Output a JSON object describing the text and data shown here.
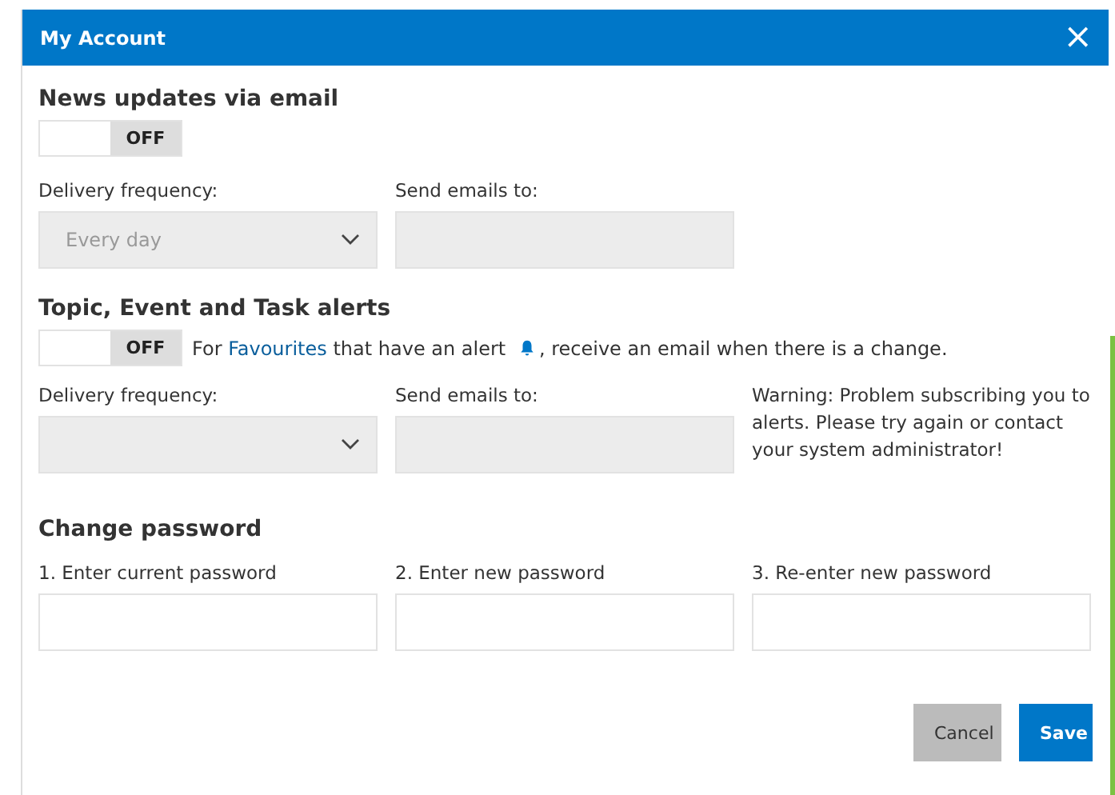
{
  "window": {
    "title": "My Account",
    "close": "×"
  },
  "news": {
    "heading": "News updates via email",
    "toggle": {
      "label": "OFF",
      "on": false
    },
    "fields": [
      {
        "kind": "select",
        "label": "Delivery frequency:",
        "value": "Every day",
        "disabled": true
      },
      {
        "kind": "text",
        "label": "Send emails to:",
        "disabled": true
      }
    ]
  },
  "alerts": {
    "heading": "Topic, Event and Task alerts",
    "toggle": {
      "label": "OFF",
      "on": false
    },
    "note": {
      "before": "For",
      "link": "Favourites",
      "middle": "that have an alert",
      "after": ", receive an email when there is a change."
    },
    "fields": [
      {
        "kind": "select",
        "label": "Delivery frequency:",
        "disabled": true
      },
      {
        "kind": "text",
        "label": "Send emails to:",
        "disabled": true
      }
    ],
    "warning": "Warning: Problem subscribing you to alerts. Please try again or contact your system administrator!"
  },
  "password": {
    "heading": "Change password",
    "fields": [
      {
        "label": "1. Enter current password"
      },
      {
        "label": "2. Enter new password"
      },
      {
        "label": "3. Re-enter new password"
      }
    ]
  },
  "buttons": [
    {
      "label": "Cancel",
      "kind": "secondary"
    },
    {
      "label": "Save",
      "kind": "primary"
    }
  ]
}
